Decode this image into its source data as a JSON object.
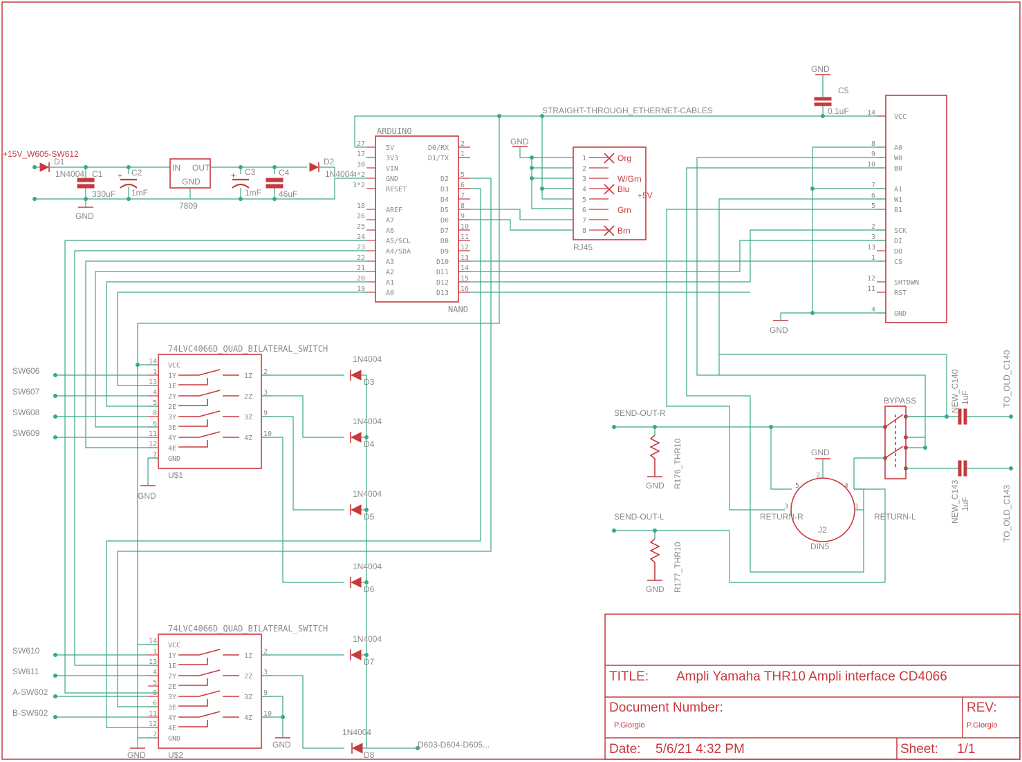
{
  "title_block": {
    "title_label": "TITLE:",
    "title": "Ampli Yamaha THR10 Ampli interface CD4066",
    "docnum_label": "Document Number:",
    "rev_label": "REV:",
    "author": "P.Giorgio",
    "rev_author": "P.Giorgio",
    "date_label": "Date:",
    "date": "5/6/21 4:32 PM",
    "sheet_label": "Sheet:",
    "sheet": "1/1"
  },
  "power": {
    "input_label": "+15V_W605-SW612",
    "d1_name": "D1",
    "d1_value": "1N4004",
    "c1_name": "C1",
    "c1_value": "330uF",
    "c2_name": "C2",
    "c2_value": "1mF",
    "reg_name": "7809",
    "reg_in": "IN",
    "reg_out": "OUT",
    "reg_gnd": "GND",
    "c3_name": "C3",
    "c3_value": "1mF",
    "c4_name": "C4",
    "c4_value": "46uF",
    "d2_name": "D2",
    "d2_value": "1N4004",
    "gnd": "GND"
  },
  "arduino": {
    "name": "ARDUINO",
    "value": "NANO",
    "left_pins": [
      {
        "num": "27",
        "name": "5V"
      },
      {
        "num": "17",
        "name": "3V3"
      },
      {
        "num": "30",
        "name": "VIN"
      },
      {
        "num": "4*2",
        "name": "GND"
      },
      {
        "num": "3*2",
        "name": "RESET"
      },
      {
        "num": "18",
        "name": "AREF"
      },
      {
        "num": "26",
        "name": "A7"
      },
      {
        "num": "25",
        "name": "A6"
      },
      {
        "num": "24",
        "name": "A5/SCL"
      },
      {
        "num": "23",
        "name": "A4/SDA"
      },
      {
        "num": "22",
        "name": "A3"
      },
      {
        "num": "21",
        "name": "A2"
      },
      {
        "num": "20",
        "name": "A1"
      },
      {
        "num": "19",
        "name": "A0"
      }
    ],
    "right_pins": [
      {
        "num": "2",
        "name": "D0/RX"
      },
      {
        "num": "1",
        "name": "D1/TX"
      },
      {
        "num": "5",
        "name": "D2"
      },
      {
        "num": "6",
        "name": "D3"
      },
      {
        "num": "7",
        "name": "D4"
      },
      {
        "num": "8",
        "name": "D5"
      },
      {
        "num": "9",
        "name": "D6"
      },
      {
        "num": "10",
        "name": "D7"
      },
      {
        "num": "11",
        "name": "D8"
      },
      {
        "num": "12",
        "name": "D9"
      },
      {
        "num": "13",
        "name": "D10"
      },
      {
        "num": "14",
        "name": "D11"
      },
      {
        "num": "15",
        "name": "D12"
      },
      {
        "num": "16",
        "name": "D13"
      }
    ]
  },
  "net_label": "STRAIGHT-THROUGH_ETHERNET-CABLES",
  "rj45": {
    "name": "RJ45",
    "gnd": "GND",
    "plus5": "+5V",
    "pins": [
      {
        "num": "1",
        "label": "Org"
      },
      {
        "num": "2",
        "label": ""
      },
      {
        "num": "3",
        "label": "W/Grn"
      },
      {
        "num": "4",
        "label": "Blu"
      },
      {
        "num": "5",
        "label": ""
      },
      {
        "num": "6",
        "label": "Grn"
      },
      {
        "num": "7",
        "label": ""
      },
      {
        "num": "8",
        "label": "Brn"
      }
    ]
  },
  "pot_ic": {
    "c5_name": "C5",
    "c5_value": "0.1uF",
    "gnd_top": "GND",
    "gnd_bottom": "GND",
    "pins": [
      {
        "num": "14",
        "name": "VCC"
      },
      {
        "num": "8",
        "name": "A0"
      },
      {
        "num": "9",
        "name": "W0"
      },
      {
        "num": "10",
        "name": "B0"
      },
      {
        "num": "7",
        "name": "A1"
      },
      {
        "num": "6",
        "name": "W1"
      },
      {
        "num": "5",
        "name": "B1"
      },
      {
        "num": "2",
        "name": "SCK"
      },
      {
        "num": "3",
        "name": "DI"
      },
      {
        "num": "13",
        "name": "DO"
      },
      {
        "num": "1",
        "name": "CS"
      },
      {
        "num": "12",
        "name": "SHTDWN"
      },
      {
        "num": "11",
        "name": "RST"
      },
      {
        "num": "4",
        "name": "GND"
      }
    ]
  },
  "switch_ics": [
    {
      "title": "74LVC4066D_QUAD_BILATERAL_SWITCH",
      "name": "U$1",
      "gnd": "GND",
      "inputs": [
        "SW606",
        "SW607",
        "SW608",
        "SW609"
      ]
    },
    {
      "title": "74LVC4066D_QUAD_BILATERAL_SWITCH",
      "name": "U$2",
      "gnd": "GND",
      "inputs": [
        "SW610",
        "SW611",
        "A-SW602",
        "B-SW602"
      ]
    }
  ],
  "switch_pins": {
    "left": [
      {
        "num": "14",
        "name": "VCC"
      },
      {
        "num": "1",
        "name": "1Y"
      },
      {
        "num": "13",
        "name": "1E"
      },
      {
        "num": "4",
        "name": "2Y"
      },
      {
        "num": "5",
        "name": "2E"
      },
      {
        "num": "8",
        "name": "3Y"
      },
      {
        "num": "6",
        "name": "3E"
      },
      {
        "num": "11",
        "name": "4Y"
      },
      {
        "num": "12",
        "name": "4E"
      },
      {
        "num": "7",
        "name": "GND"
      }
    ],
    "right": [
      {
        "num": "2",
        "name": "1Z"
      },
      {
        "num": "3",
        "name": "2Z"
      },
      {
        "num": "9",
        "name": "3Z"
      },
      {
        "num": "10",
        "name": "4Z"
      }
    ]
  },
  "diodes": [
    {
      "name": "D3",
      "value": "1N4004"
    },
    {
      "name": "D4",
      "value": "1N4004"
    },
    {
      "name": "D5",
      "value": "1N4004"
    },
    {
      "name": "D6",
      "value": "1N4004"
    },
    {
      "name": "D7",
      "value": "1N4004"
    },
    {
      "name": "D8",
      "value": "1N4004"
    }
  ],
  "diode_bus_label": "D603-D604-D605...",
  "audio": {
    "send_r": "SEND-OUT-R",
    "send_l": "SEND-OUT-L",
    "r176": "R176_THR10",
    "r177": "R177_THR10",
    "gnd": "GND",
    "bypass": "BYPASS",
    "j2_name": "J2",
    "j2_value": "DIN5",
    "j2_gnd": "GND",
    "j2_pins": [
      "1",
      "2",
      "3",
      "4",
      "5"
    ],
    "return_r": "RETURN-R",
    "return_l": "RETURN-L",
    "c140": "NEW_C140",
    "c143": "NEW_C143",
    "cap_val": "1uF",
    "to_c140": "TO_OLD_C140",
    "to_c143": "TO_OLD_C143"
  }
}
